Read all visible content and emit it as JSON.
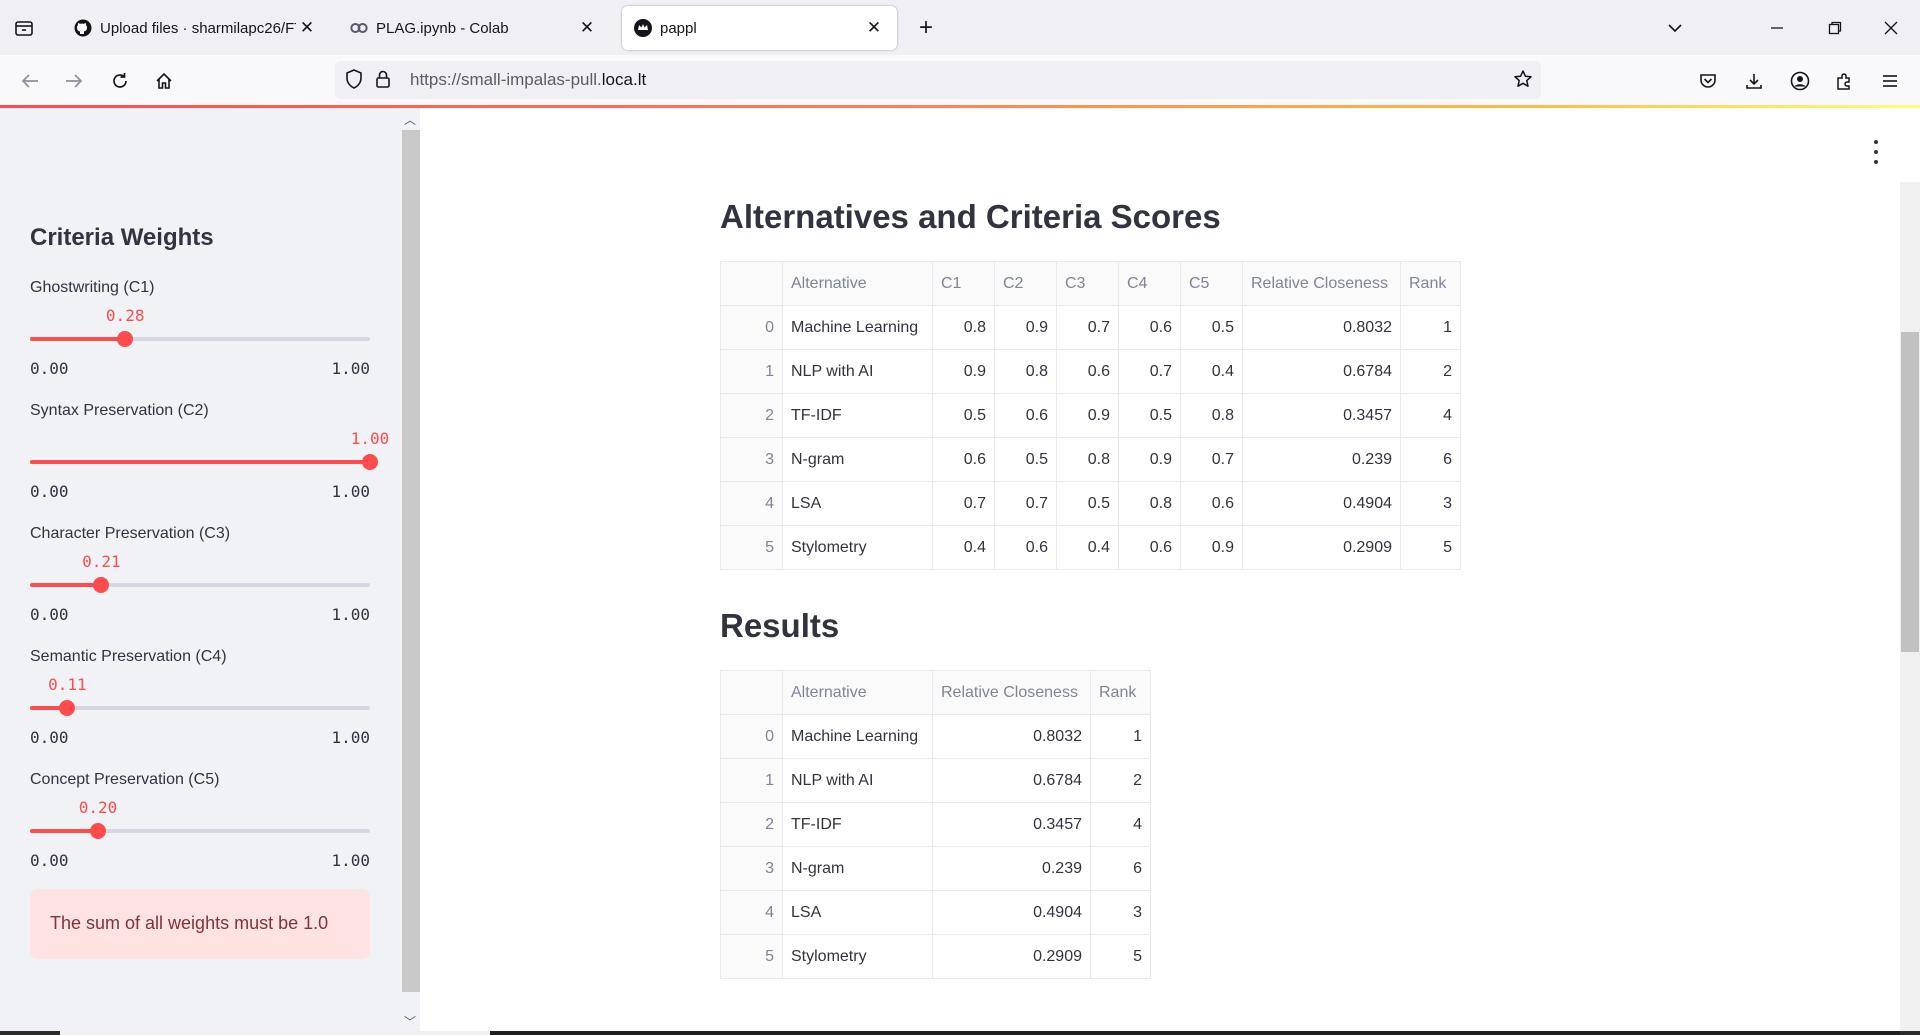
{
  "browser": {
    "tabs": [
      {
        "title": "Upload files · sharmilapc26/FTL",
        "favicon": "github-icon",
        "active": false
      },
      {
        "title": "PLAG.ipynb - Colab",
        "favicon": "colab-icon",
        "active": false
      },
      {
        "title": "pappl",
        "favicon": "streamlit-crown-icon",
        "active": true
      }
    ],
    "url_prefix": "https://small-impalas-pull.",
    "url_domain": "loca.lt"
  },
  "sidebar": {
    "title": "Criteria Weights",
    "sliders": [
      {
        "label": "Ghostwriting (C1)",
        "value": 0.28,
        "value_text": "0.28",
        "min": "0.00",
        "max": "1.00"
      },
      {
        "label": "Syntax Preservation (C2)",
        "value": 1.0,
        "value_text": "1.00",
        "min": "0.00",
        "max": "1.00"
      },
      {
        "label": "Character Preservation (C3)",
        "value": 0.21,
        "value_text": "0.21",
        "min": "0.00",
        "max": "1.00"
      },
      {
        "label": "Semantic Preservation (C4)",
        "value": 0.11,
        "value_text": "0.11",
        "min": "0.00",
        "max": "1.00"
      },
      {
        "label": "Concept Preservation (C5)",
        "value": 0.2,
        "value_text": "0.20",
        "min": "0.00",
        "max": "1.00"
      }
    ],
    "alert": "The sum of all weights must be 1.0"
  },
  "main": {
    "scores_title": "Alternatives and Criteria Scores",
    "scores_table": {
      "headers": [
        "",
        "Alternative",
        "C1",
        "C2",
        "C3",
        "C4",
        "C5",
        "Relative Closeness",
        "Rank"
      ],
      "rows": [
        [
          "0",
          "Machine Learning",
          "0.8",
          "0.9",
          "0.7",
          "0.6",
          "0.5",
          "0.8032",
          "1"
        ],
        [
          "1",
          "NLP with AI",
          "0.9",
          "0.8",
          "0.6",
          "0.7",
          "0.4",
          "0.6784",
          "2"
        ],
        [
          "2",
          "TF-IDF",
          "0.5",
          "0.6",
          "0.9",
          "0.5",
          "0.8",
          "0.3457",
          "4"
        ],
        [
          "3",
          "N-gram",
          "0.6",
          "0.5",
          "0.8",
          "0.9",
          "0.7",
          "0.239",
          "6"
        ],
        [
          "4",
          "LSA",
          "0.7",
          "0.7",
          "0.5",
          "0.8",
          "0.6",
          "0.4904",
          "3"
        ],
        [
          "5",
          "Stylometry",
          "0.4",
          "0.6",
          "0.4",
          "0.6",
          "0.9",
          "0.2909",
          "5"
        ]
      ]
    },
    "results_title": "Results",
    "results_table": {
      "headers": [
        "",
        "Alternative",
        "Relative Closeness",
        "Rank"
      ],
      "rows": [
        [
          "0",
          "Machine Learning",
          "0.8032",
          "1"
        ],
        [
          "1",
          "NLP with AI",
          "0.6784",
          "2"
        ],
        [
          "2",
          "TF-IDF",
          "0.3457",
          "4"
        ],
        [
          "3",
          "N-gram",
          "0.239",
          "6"
        ],
        [
          "4",
          "LSA",
          "0.4904",
          "3"
        ],
        [
          "5",
          "Stylometry",
          "0.2909",
          "5"
        ]
      ]
    }
  }
}
